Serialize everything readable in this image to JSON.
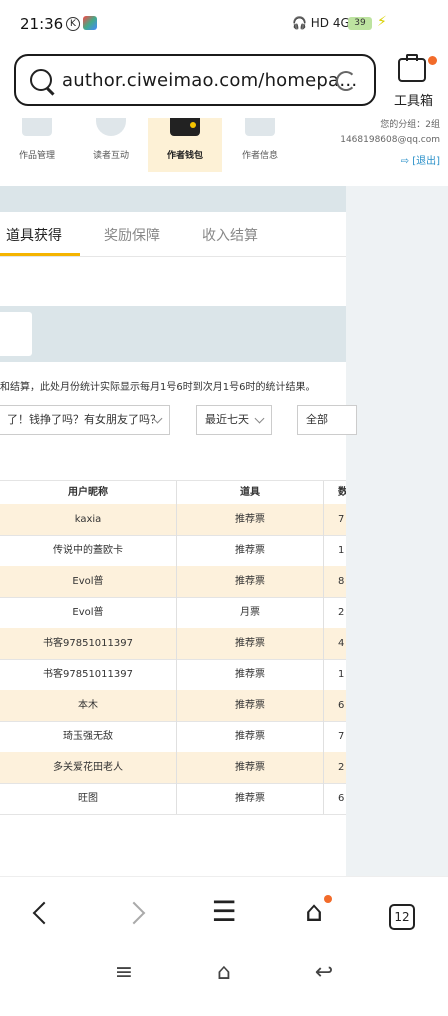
{
  "status": {
    "time": "21:36",
    "indicators": "🎧 HD 4G+",
    "battery": "39"
  },
  "browser": {
    "url": "author.ciweimao.com/homepa…",
    "tools_label": "工具箱"
  },
  "nav": {
    "items": [
      {
        "label": "作品管理"
      },
      {
        "label": "读者互动"
      },
      {
        "label": "作者钱包"
      },
      {
        "label": "作者信息"
      }
    ],
    "account_group": "您的分组：2组",
    "account_email": "1468198608@qq.com",
    "quit_label": "[退出]"
  },
  "tabs": [
    {
      "label": "道具获得"
    },
    {
      "label": "奖励保障"
    },
    {
      "label": "收入结算"
    }
  ],
  "notice": "和结算，此处月份统计实际显示每月1号6时到次月1号6时的统计结果。",
  "filters": {
    "book": "了！钱挣了吗？有女朋友了吗？",
    "range": "最近七天",
    "type": "全部"
  },
  "table": {
    "headers": [
      "用户昵称",
      "道具",
      "数"
    ],
    "rows": [
      {
        "user": "kaxia",
        "item": "推荐票",
        "count": "7"
      },
      {
        "user": "传说中的蓋欧卡",
        "item": "推荐票",
        "count": "1"
      },
      {
        "user": "Evol普",
        "item": "推荐票",
        "count": "8"
      },
      {
        "user": "Evol普",
        "item": "月票",
        "count": "2"
      },
      {
        "user": "书客97851011397",
        "item": "推荐票",
        "count": "4"
      },
      {
        "user": "书客97851011397",
        "item": "推荐票",
        "count": "1"
      },
      {
        "user": "本木",
        "item": "推荐票",
        "count": "6"
      },
      {
        "user": "琦玉强无敌",
        "item": "推荐票",
        "count": "7"
      },
      {
        "user": "多关爱花田老人",
        "item": "推荐票",
        "count": "2"
      },
      {
        "user": "旺图",
        "item": "推荐票",
        "count": "6"
      }
    ]
  },
  "bottom_nav": {
    "tab_count": "12"
  }
}
